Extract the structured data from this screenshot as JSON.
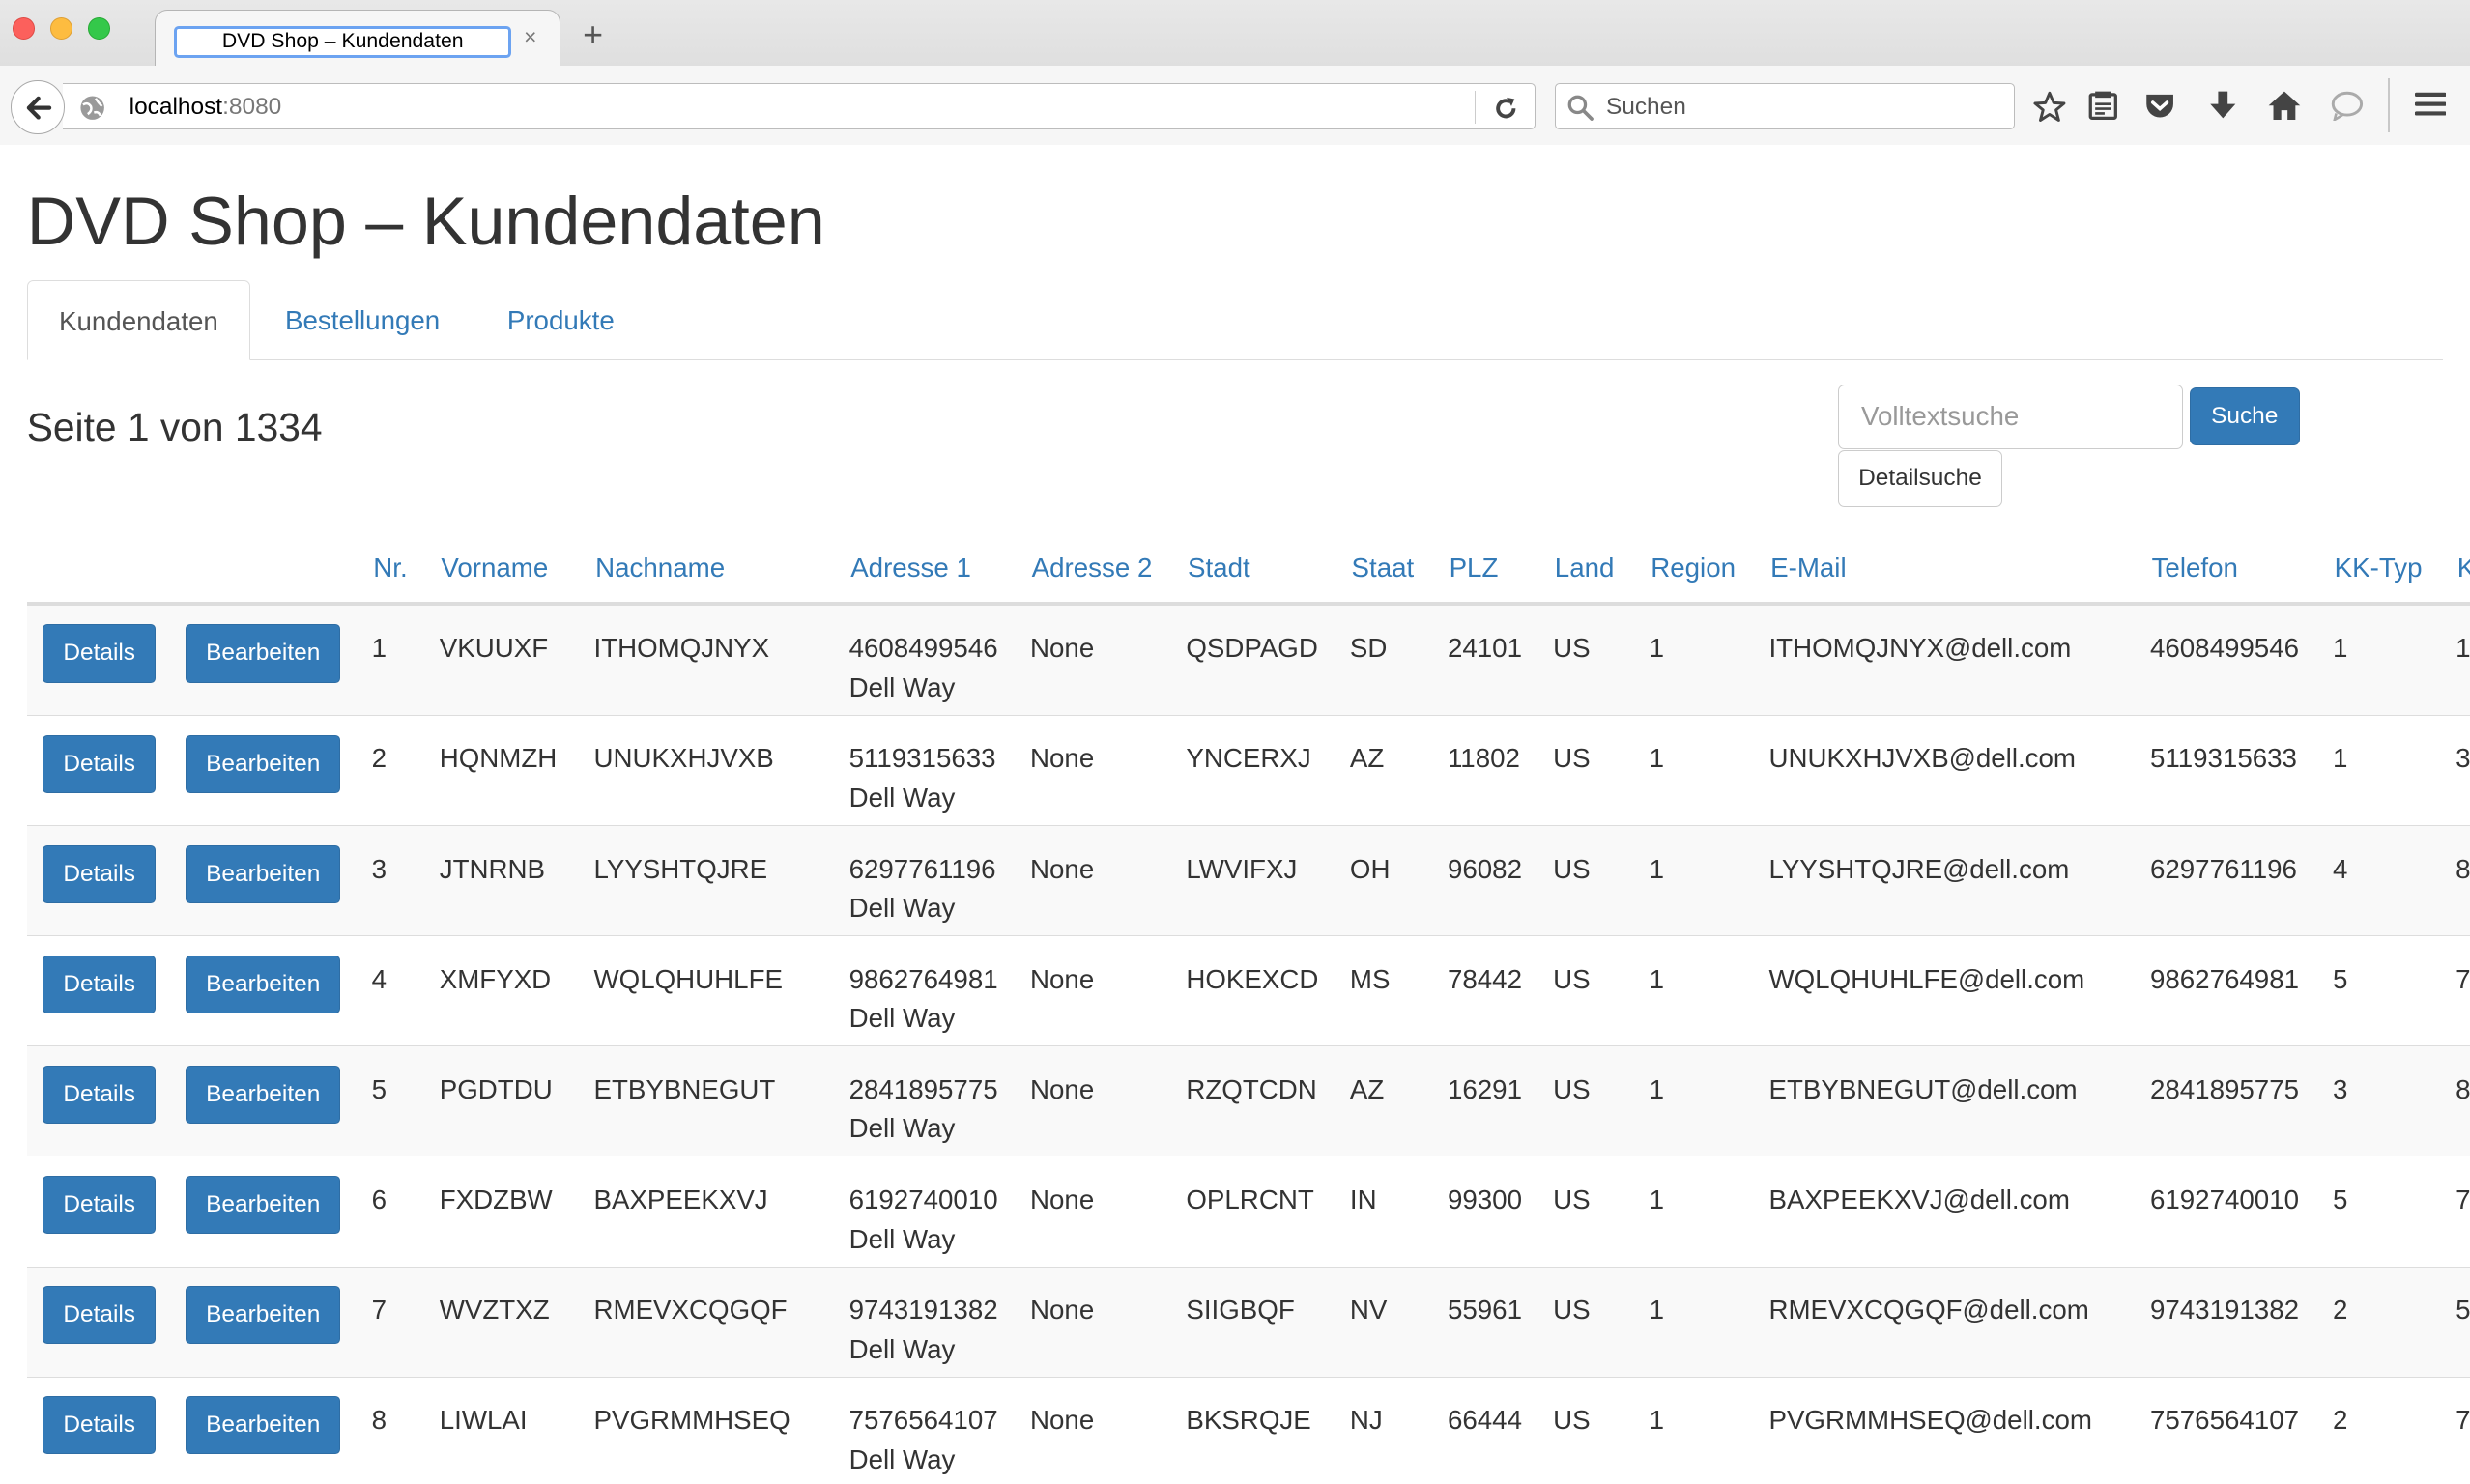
{
  "browser": {
    "tab_title": "DVD Shop – Kundendaten",
    "tab_close": "×",
    "new_tab": "+",
    "url_host": "localhost",
    "url_port": ":8080",
    "search_placeholder": "Suchen",
    "icons": [
      "back-arrow-icon",
      "globe-icon",
      "reload-icon",
      "search-icon",
      "star-icon",
      "reading-list-icon",
      "pocket-icon",
      "download-icon",
      "home-icon",
      "chat-icon",
      "hamburger-menu-icon"
    ]
  },
  "page": {
    "title": "DVD Shop – Kundendaten",
    "tabs": [
      {
        "label": "Kundendaten",
        "active": true
      },
      {
        "label": "Bestellungen",
        "active": false
      },
      {
        "label": "Produkte",
        "active": false
      }
    ],
    "page_info": "Seite 1 von 1334",
    "search": {
      "placeholder": "Volltextsuche",
      "button": "Suche",
      "detail_button": "Detailsuche"
    },
    "accent_color": "#337ab7"
  },
  "table": {
    "columns": [
      "Nr.",
      "Vorname",
      "Nachname",
      "Adresse 1",
      "Adresse 2",
      "Stadt",
      "Staat",
      "PLZ",
      "Land",
      "Region",
      "E-Mail",
      "Telefon",
      "KK-Typ",
      "K"
    ],
    "details_label": "Details",
    "edit_label": "Bearbeiten",
    "rows": [
      {
        "nr": "1",
        "vorname": "VKUUXF",
        "nachname": "ITHOMQJNYX",
        "adresse1_line1": "4608499546",
        "adresse1_line2": "Dell Way",
        "adresse2": "None",
        "stadt": "QSDPAGD",
        "staat": "SD",
        "plz": "24101",
        "land": "US",
        "region": "1",
        "email": "ITHOMQJNYX@dell.com",
        "telefon": "4608499546",
        "kktyp": "1",
        "k": "1"
      },
      {
        "nr": "2",
        "vorname": "HQNMZH",
        "nachname": "UNUKXHJVXB",
        "adresse1_line1": "5119315633",
        "adresse1_line2": "Dell Way",
        "adresse2": "None",
        "stadt": "YNCERXJ",
        "staat": "AZ",
        "plz": "11802",
        "land": "US",
        "region": "1",
        "email": "UNUKXHJVXB@dell.com",
        "telefon": "5119315633",
        "kktyp": "1",
        "k": "3"
      },
      {
        "nr": "3",
        "vorname": "JTNRNB",
        "nachname": "LYYSHTQJRE",
        "adresse1_line1": "6297761196",
        "adresse1_line2": "Dell Way",
        "adresse2": "None",
        "stadt": "LWVIFXJ",
        "staat": "OH",
        "plz": "96082",
        "land": "US",
        "region": "1",
        "email": "LYYSHTQJRE@dell.com",
        "telefon": "6297761196",
        "kktyp": "4",
        "k": "8"
      },
      {
        "nr": "4",
        "vorname": "XMFYXD",
        "nachname": "WQLQHUHLFE",
        "adresse1_line1": "9862764981",
        "adresse1_line2": "Dell Way",
        "adresse2": "None",
        "stadt": "HOKEXCD",
        "staat": "MS",
        "plz": "78442",
        "land": "US",
        "region": "1",
        "email": "WQLQHUHLFE@dell.com",
        "telefon": "9862764981",
        "kktyp": "5",
        "k": "7"
      },
      {
        "nr": "5",
        "vorname": "PGDTDU",
        "nachname": "ETBYBNEGUT",
        "adresse1_line1": "2841895775",
        "adresse1_line2": "Dell Way",
        "adresse2": "None",
        "stadt": "RZQTCDN",
        "staat": "AZ",
        "plz": "16291",
        "land": "US",
        "region": "1",
        "email": "ETBYBNEGUT@dell.com",
        "telefon": "2841895775",
        "kktyp": "3",
        "k": "8"
      },
      {
        "nr": "6",
        "vorname": "FXDZBW",
        "nachname": "BAXPEEKXVJ",
        "adresse1_line1": "6192740010",
        "adresse1_line2": "Dell Way",
        "adresse2": "None",
        "stadt": "OPLRCNT",
        "staat": "IN",
        "plz": "99300",
        "land": "US",
        "region": "1",
        "email": "BAXPEEKXVJ@dell.com",
        "telefon": "6192740010",
        "kktyp": "5",
        "k": "7"
      },
      {
        "nr": "7",
        "vorname": "WVZTXZ",
        "nachname": "RMEVXCQGQF",
        "adresse1_line1": "9743191382",
        "adresse1_line2": "Dell Way",
        "adresse2": "None",
        "stadt": "SIIGBQF",
        "staat": "NV",
        "plz": "55961",
        "land": "US",
        "region": "1",
        "email": "RMEVXCQGQF@dell.com",
        "telefon": "9743191382",
        "kktyp": "2",
        "k": "5"
      },
      {
        "nr": "8",
        "vorname": "LIWLAI",
        "nachname": "PVGRMMHSEQ",
        "adresse1_line1": "7576564107",
        "adresse1_line2": "Dell Way",
        "adresse2": "None",
        "stadt": "BKSRQJE",
        "staat": "NJ",
        "plz": "66444",
        "land": "US",
        "region": "1",
        "email": "PVGRMMHSEQ@dell.com",
        "telefon": "7576564107",
        "kktyp": "2",
        "k": "7"
      }
    ]
  }
}
